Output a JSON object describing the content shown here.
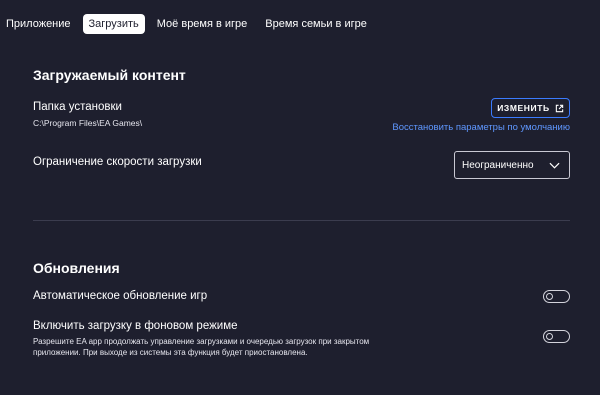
{
  "tabs": [
    {
      "label": "Приложение",
      "active": false
    },
    {
      "label": "Загрузить",
      "active": true
    },
    {
      "label": "Моё время в игре",
      "active": false
    },
    {
      "label": "Время семьи в игре",
      "active": false
    }
  ],
  "download": {
    "title": "Загружаемый контент",
    "install_folder_label": "Папка установки",
    "install_folder_path": "C:\\Program Files\\EA Games\\",
    "change_button": "ИЗМЕНИТЬ",
    "restore_defaults": "Восстановить параметры по умолчанию",
    "speed_limit_label": "Ограничение скорости загрузки",
    "speed_limit_value": "Неограниченно"
  },
  "updates": {
    "title": "Обновления",
    "auto_update_label": "Автоматическое обновление игр",
    "auto_update_enabled": false,
    "background_label": "Включить загрузку в фоновом режиме",
    "background_desc": "Разрешите EA app продолжать управление загрузками и очередью загрузок при закрытом приложении. При выходе из системы эта функция будет приостановлена.",
    "background_enabled": false
  },
  "colors": {
    "background": "#1e1f2e",
    "accent": "#3b7bff",
    "link": "#5f97ff"
  }
}
